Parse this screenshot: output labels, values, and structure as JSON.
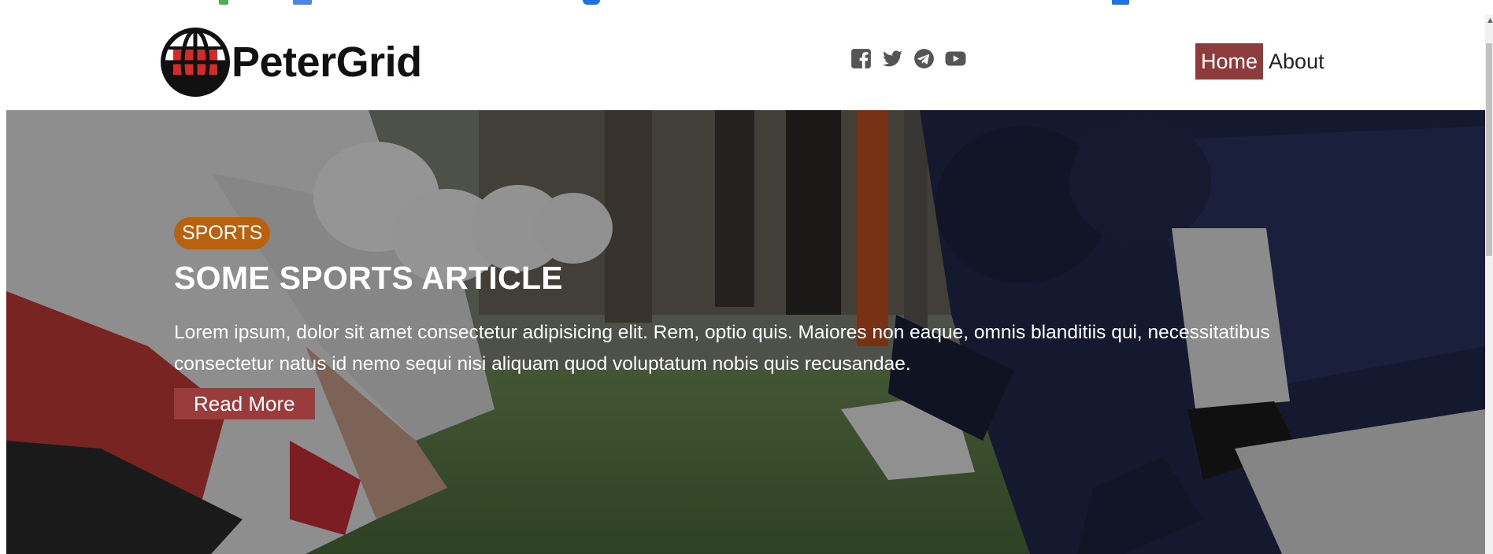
{
  "site": {
    "brand": "PeterGrid"
  },
  "nav": {
    "socials": [
      "facebook-square-icon",
      "twitter-icon",
      "telegram-icon",
      "youtube-icon"
    ],
    "links": [
      {
        "label": "Home",
        "active": true
      },
      {
        "label": "About",
        "active": false
      }
    ]
  },
  "hero": {
    "badge": "SPORTS",
    "title": "SOME SPORTS ARTICLE",
    "description": "Lorem ipsum, dolor sit amet consectetur adipisicing elit. Rem, optio quis. Maiores non eaque, omnis blanditiis qui, necessitatibus consectetur natus id nemo sequi nisi aliquam quod voluptatum nobis quis recusandae.",
    "button": "Read More"
  },
  "colors": {
    "accent": "#8e3b3b",
    "badge": "#b8620f",
    "logo_red": "#d42a2a"
  }
}
